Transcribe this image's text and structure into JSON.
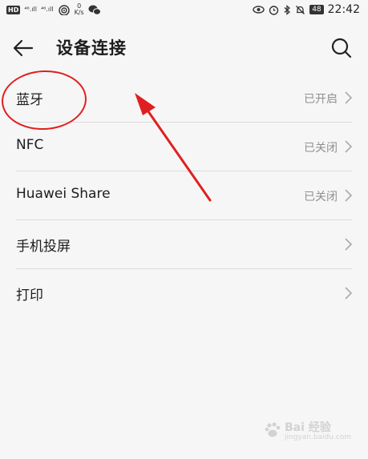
{
  "statusbar": {
    "hd_badge": "HD",
    "sig1": "⁴⁶.ıll",
    "sig2": "⁴⁶.ıll",
    "speed_value": "0",
    "speed_unit": "K/s",
    "battery": "48",
    "time": "22:42"
  },
  "appbar": {
    "title": "设备连接"
  },
  "rows": [
    {
      "label": "蓝牙",
      "status": "已开启"
    },
    {
      "label": "NFC",
      "status": "已关闭"
    },
    {
      "label": "Huawei Share",
      "status": "已关闭"
    },
    {
      "label": "手机投屏",
      "status": ""
    },
    {
      "label": "打印",
      "status": ""
    }
  ],
  "watermark": {
    "text": "Bai 经验",
    "sub": "jingyan.baidu.com"
  },
  "colors": {
    "background": "#f6f6f6",
    "annotation_red": "#e02020",
    "status_gray": "#8f8f8f"
  },
  "icons": [
    "back-arrow-icon",
    "search-icon",
    "chevron-right-icon",
    "wifi-icon",
    "wechat-icon",
    "eye-icon",
    "alarm-icon",
    "bluetooth-icon",
    "mute-bell-icon",
    "battery-icon"
  ]
}
